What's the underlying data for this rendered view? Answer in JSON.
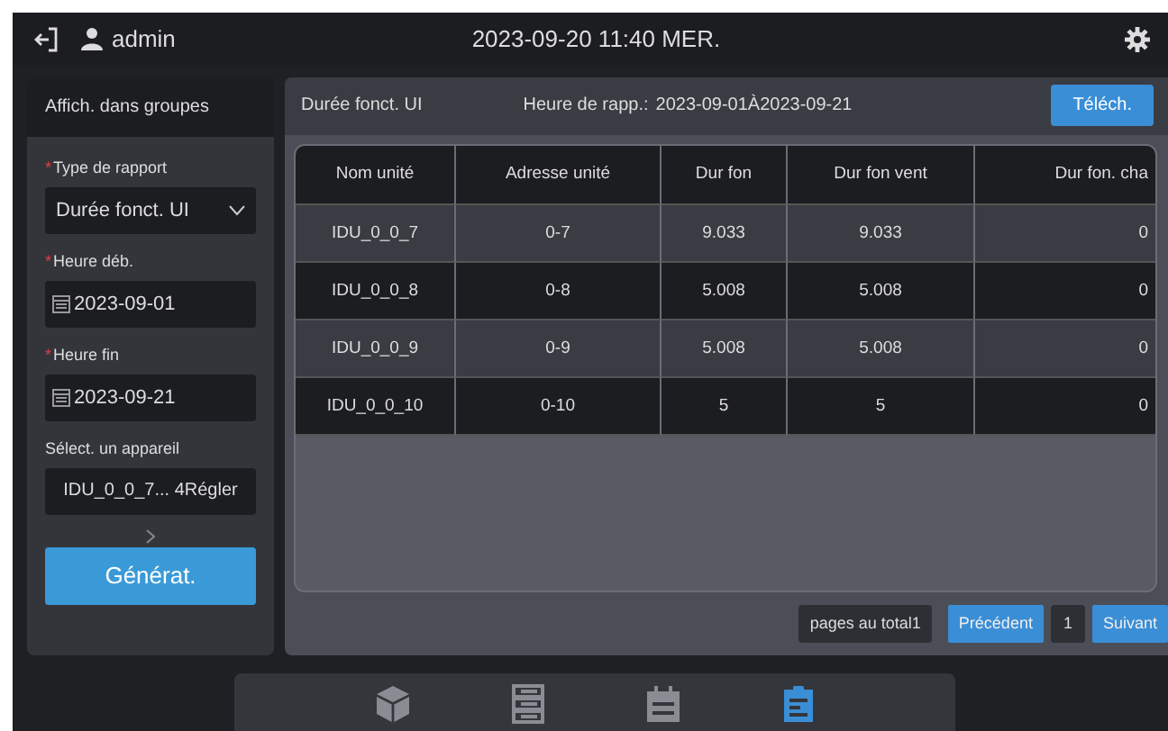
{
  "top_bar": {
    "user": "admin",
    "datetime": "2023-09-20 11:40 MER."
  },
  "sidebar": {
    "title": "Affich. dans groupes",
    "fields": [
      {
        "kind": "select",
        "label": "Type de rapport",
        "required_mark": "*",
        "value": "Durée fonct. UI"
      },
      {
        "kind": "date",
        "label": "Heure déb.",
        "required_mark": "*",
        "value": "2023-09-01"
      },
      {
        "kind": "date",
        "label": "Heure fin",
        "required_mark": "*",
        "value": "2023-09-21"
      },
      {
        "kind": "text",
        "label": "Sélect. un appareil",
        "value": "IDU_0_0_7... 4Régler"
      }
    ],
    "generate_button": "Générat."
  },
  "report": {
    "title": "Durée fonct. UI",
    "period_label": "Heure de rapp.:",
    "period": "2023-09-01À2023-09-21",
    "download_button": "Téléch."
  },
  "table": {
    "columns": [
      "Nom unité",
      "Adresse unité",
      "Dur fon",
      "Dur fon vent",
      "Dur fon. cha"
    ],
    "rows": [
      [
        "IDU_0_0_7",
        "0-7",
        "9.033",
        "9.033",
        "0"
      ],
      [
        "IDU_0_0_8",
        "0-8",
        "5.008",
        "5.008",
        "0"
      ],
      [
        "IDU_0_0_9",
        "0-9",
        "5.008",
        "5.008",
        "0"
      ],
      [
        "IDU_0_0_10",
        "0-10",
        "5",
        "5",
        "0"
      ]
    ]
  },
  "pagination": {
    "total": "pages au total1",
    "previous": "Précédent",
    "page": "1",
    "next": "Suivant"
  },
  "bottom_nav": [
    {
      "kind": "cube",
      "selected": false
    },
    {
      "kind": "server",
      "selected": false
    },
    {
      "kind": "calendar",
      "selected": false
    },
    {
      "kind": "clipboard",
      "selected": true
    }
  ]
}
